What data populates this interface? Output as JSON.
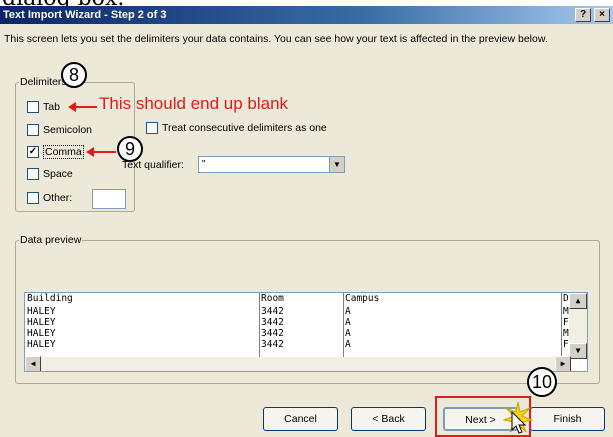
{
  "top_caption": "dialog box.",
  "window": {
    "title": "Text Import Wizard - Step 2 of 3",
    "help_btn": "?",
    "close_btn": "×",
    "description": "This screen lets you set the delimiters your data contains.  You can see how your text is affected in the preview below."
  },
  "delimiters": {
    "label": "Delimiters",
    "tab": {
      "label": "Tab",
      "checked": false
    },
    "semicolon": {
      "label": "Semicolon",
      "checked": false
    },
    "comma": {
      "label": "Comma",
      "checked": true
    },
    "space": {
      "label": "Space",
      "checked": false
    },
    "other": {
      "label": "Other:",
      "checked": false,
      "value": ""
    }
  },
  "consecutive": {
    "label": "Treat consecutive delimiters as one",
    "checked": false
  },
  "text_qualifier": {
    "label": "Text qualifier:",
    "value": "\""
  },
  "preview": {
    "label": "Data preview",
    "columns": [
      "Building",
      "Room",
      "Campus",
      "D"
    ],
    "rows": [
      [
        "HALEY",
        "3442",
        "A",
        "M"
      ],
      [
        "HALEY",
        "3442",
        "A",
        "F"
      ],
      [
        "HALEY",
        "3442",
        "A",
        "M"
      ],
      [
        "HALEY",
        "3442",
        "A",
        "F"
      ]
    ]
  },
  "buttons": {
    "cancel": "Cancel",
    "back": "< Back",
    "next": "Next >",
    "finish": "Finish"
  },
  "annotations": {
    "num8": "8",
    "num9": "9",
    "num10": "10",
    "blank_note": "This should end up blank"
  },
  "colors": {
    "annotation": "#e01b1b",
    "titlebar": "#0a246a"
  }
}
